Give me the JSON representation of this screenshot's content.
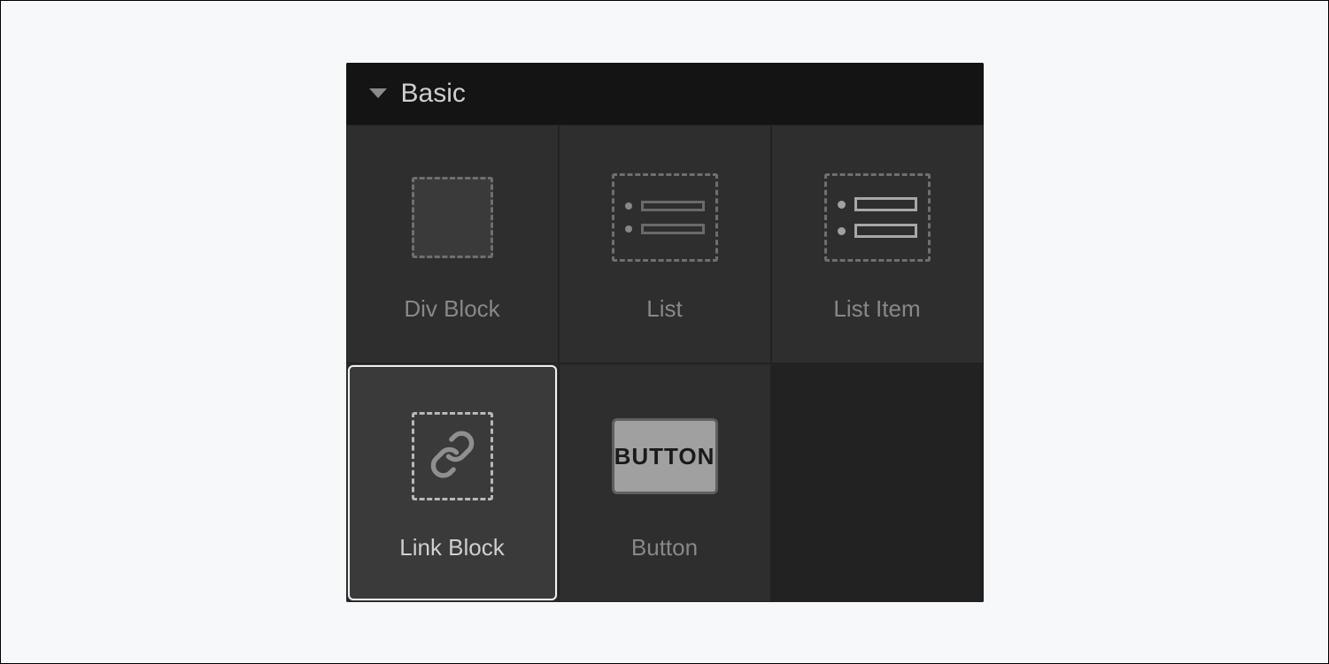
{
  "section": {
    "title": "Basic"
  },
  "tiles": [
    {
      "label": "Div Block"
    },
    {
      "label": "List"
    },
    {
      "label": "List Item"
    },
    {
      "label": "Link Block"
    },
    {
      "label": "Button"
    }
  ],
  "button_icon_text": "BUTTON"
}
